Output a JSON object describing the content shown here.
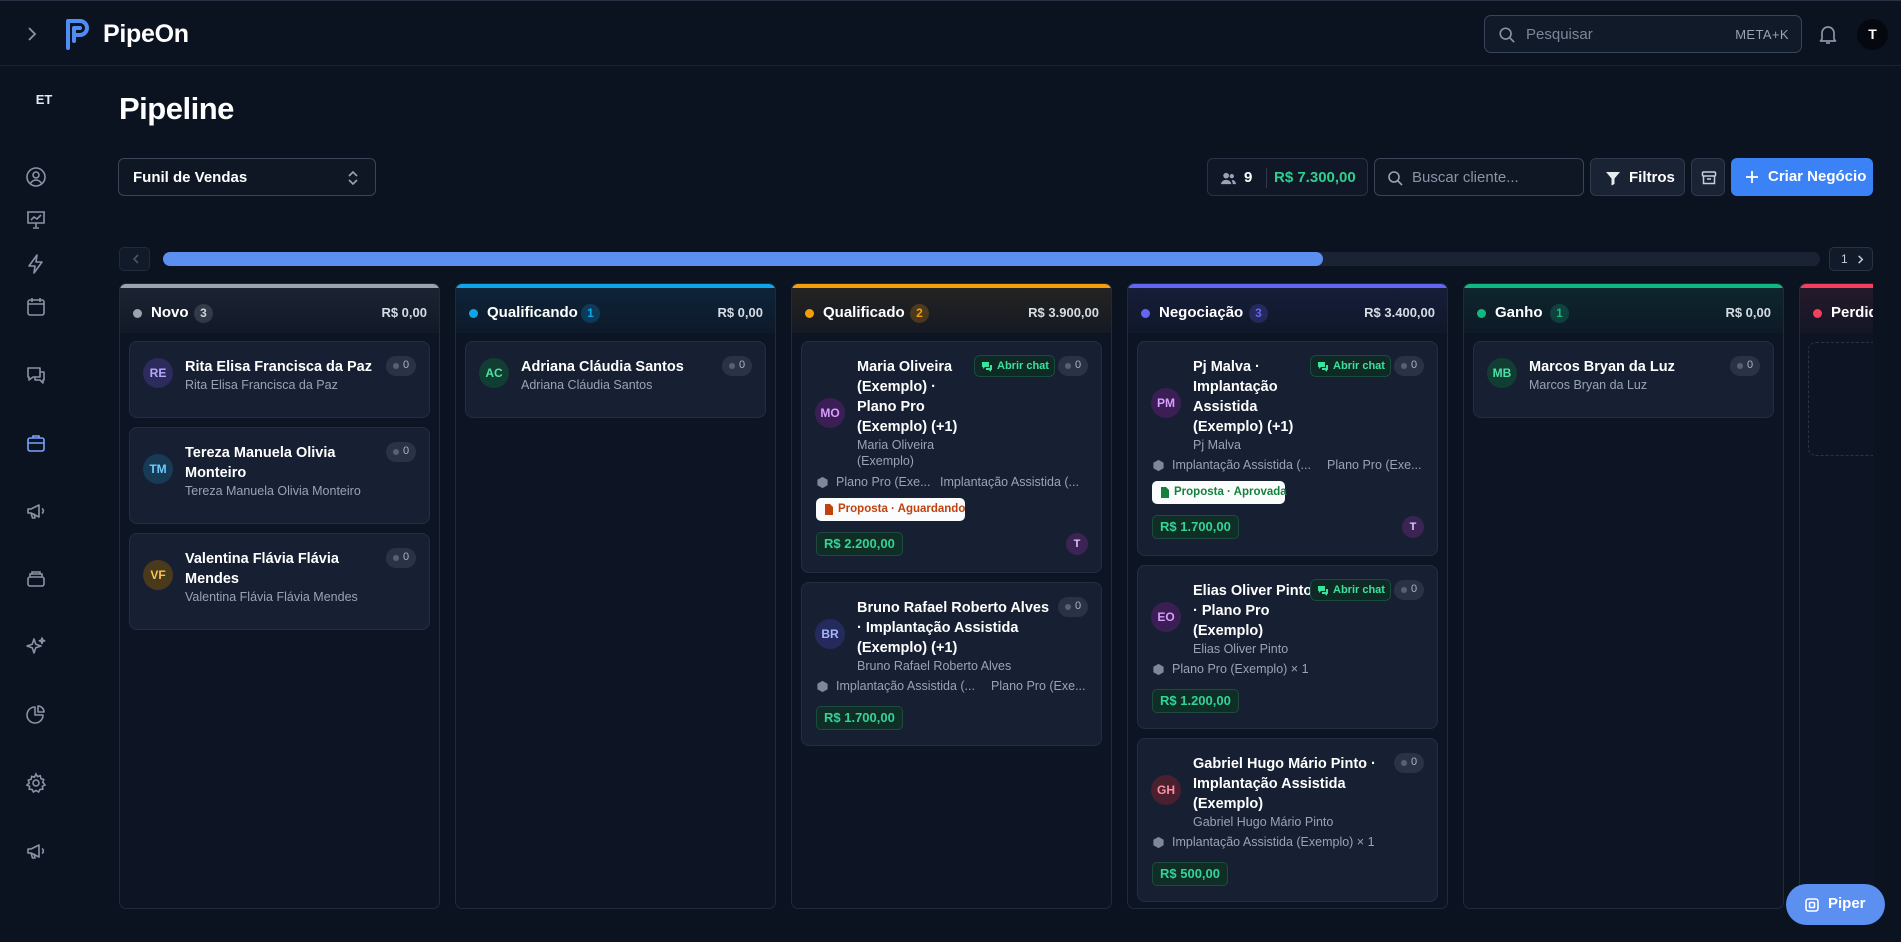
{
  "app": {
    "name": "PipeOn"
  },
  "topbar": {
    "search_placeholder": "Pesquisar",
    "search_shortcut": "META+K",
    "user_initial": "T"
  },
  "sidebar": {
    "workspace": "ET"
  },
  "page": {
    "title": "Pipeline",
    "funnel": "Funil de Vendas"
  },
  "toolbar": {
    "deal_count": "9",
    "deal_total": "R$ 7.300,00",
    "client_search_placeholder": "Buscar cliente...",
    "filters_label": "Filtros",
    "create_label": "Criar Negócio"
  },
  "scroller": {
    "page": "1",
    "progress": 0.7
  },
  "columns": [
    {
      "name": "Novo",
      "count": "3",
      "total": "R$ 0,00",
      "color": "#9ca3af",
      "cards": [
        {
          "initials": "RE",
          "title": "Rita Elisa Francisca da Paz",
          "subtitle": "Rita Elisa Francisca da Paz",
          "tasks": "0"
        },
        {
          "initials": "TM",
          "title": "Tereza Manuela Olivia Monteiro",
          "subtitle": "Tereza Manuela Olivia Monteiro",
          "tasks": "0"
        },
        {
          "initials": "VF",
          "title": "Valentina Flávia Flávia Mendes",
          "subtitle": "Valentina Flávia Flávia Mendes",
          "tasks": "0"
        }
      ]
    },
    {
      "name": "Qualificando",
      "count": "1",
      "total": "R$ 0,00",
      "color": "#0ea5e9",
      "cards": [
        {
          "initials": "AC",
          "title": "Adriana Cláudia Santos",
          "subtitle": "Adriana Cláudia Santos",
          "tasks": "0"
        }
      ]
    },
    {
      "name": "Qualificado",
      "count": "2",
      "total": "R$ 3.900,00",
      "color": "#f59e0b",
      "cards": [
        {
          "initials": "MO",
          "title": "Maria Oliveira (Exemplo) · Plano Pro (Exemplo) (+1)",
          "subtitle": "Maria Oliveira (Exemplo)",
          "tasks": "0",
          "chat_label": "Abrir chat",
          "products": [
            "Plano Pro (Exe...",
            "Implantação Assistida (..."
          ],
          "badge": "Proposta · Aguardando",
          "value": "R$ 2.200,00",
          "owner": "T"
        },
        {
          "initials": "BR",
          "title": "Bruno Rafael Roberto Alves · Implantação Assistida (Exemplo) (+1)",
          "subtitle": "Bruno Rafael Roberto Alves",
          "tasks": "0",
          "products": [
            "Implantação Assistida (...",
            "Plano Pro (Exe..."
          ],
          "value": "R$ 1.700,00"
        }
      ]
    },
    {
      "name": "Negociação",
      "count": "3",
      "total": "R$ 3.400,00",
      "color": "#6366f1",
      "cards": [
        {
          "initials": "PM",
          "title": "Pj Malva · Implantação Assistida (Exemplo) (+1)",
          "subtitle": "Pj Malva",
          "tasks": "0",
          "chat_label": "Abrir chat",
          "products": [
            "Implantação Assistida (...",
            "Plano Pro (Exe..."
          ],
          "badge": "Proposta · Aprovada",
          "value": "R$ 1.700,00",
          "owner": "T"
        },
        {
          "initials": "EO",
          "title": "Elias Oliver Pinto · Plano Pro (Exemplo)",
          "subtitle": "Elias Oliver Pinto",
          "tasks": "0",
          "chat_label": "Abrir chat",
          "products": [
            "Plano Pro (Exemplo) × 1"
          ],
          "value": "R$ 1.200,00"
        },
        {
          "initials": "GH",
          "title": "Gabriel Hugo Mário Pinto · Implantação Assistida (Exemplo)",
          "subtitle": "Gabriel Hugo Mário Pinto",
          "tasks": "0",
          "products": [
            "Implantação Assistida (Exemplo) × 1"
          ],
          "value": "R$ 500,00"
        }
      ]
    },
    {
      "name": "Ganho",
      "count": "1",
      "total": "R$ 0,00",
      "color": "#10b981",
      "cards": [
        {
          "initials": "MB",
          "title": "Marcos Bryan da Luz",
          "subtitle": "Marcos Bryan da Luz",
          "tasks": "0"
        }
      ]
    },
    {
      "name": "Perdido",
      "count": "",
      "total": "",
      "color": "#f43f5e",
      "cards": []
    }
  ],
  "assistant": {
    "label": "Piper"
  }
}
